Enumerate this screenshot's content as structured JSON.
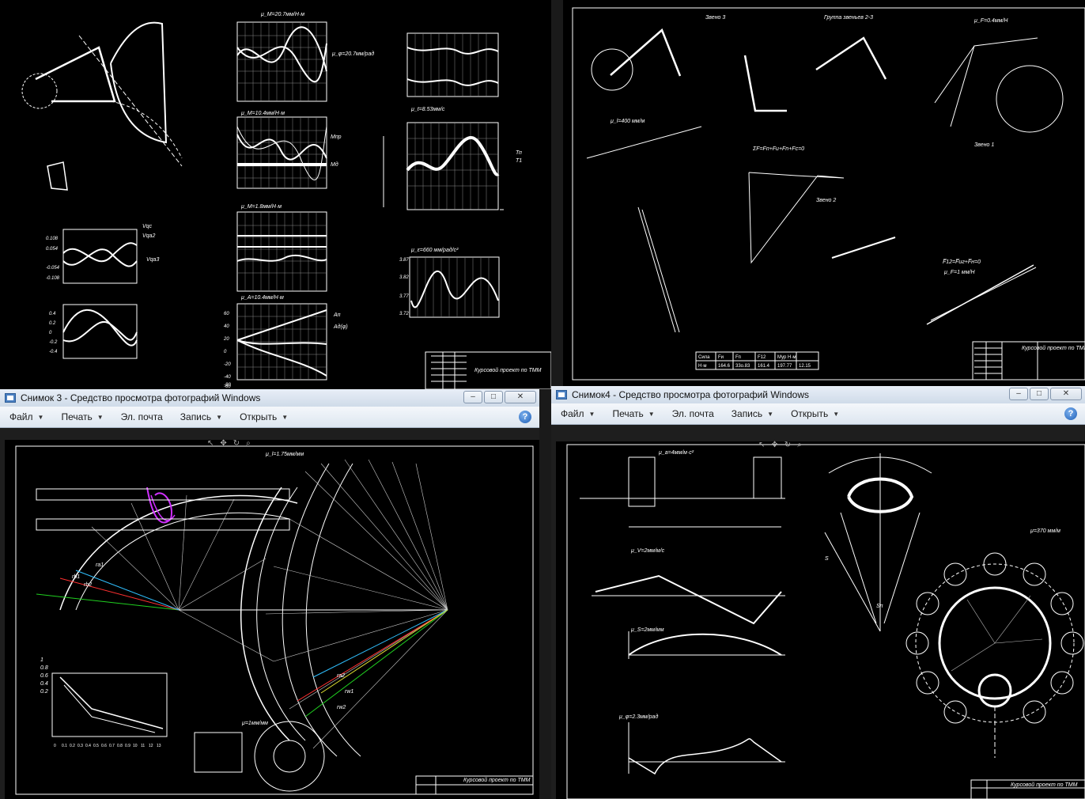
{
  "windows": {
    "photo3": {
      "title": "Снимок 3 - Средство просмотра фотографий Windows",
      "menu": [
        {
          "label": "Файл",
          "has_dropdown": true
        },
        {
          "label": "Печать",
          "has_dropdown": true
        },
        {
          "label": "Эл. почта",
          "has_dropdown": false
        },
        {
          "label": "Запись",
          "has_dropdown": true
        },
        {
          "label": "Открыть",
          "has_dropdown": true
        }
      ],
      "help": "?"
    },
    "photo4": {
      "title": "Снимок4 - Средство просмотра фотографий Windows",
      "menu": [
        {
          "label": "Файл",
          "has_dropdown": true
        },
        {
          "label": "Печать",
          "has_dropdown": true
        },
        {
          "label": "Эл. почта",
          "has_dropdown": false
        },
        {
          "label": "Запись",
          "has_dropdown": true
        },
        {
          "label": "Открыть",
          "has_dropdown": true
        }
      ],
      "help": "?"
    }
  },
  "window_controls": {
    "minimize": "–",
    "maximize": "□",
    "close": "✕"
  },
  "drawings": {
    "top_left": {
      "labels": [
        "μ_M=20.7мм/Н·м",
        "μ_φ=20.7мм/рад",
        "μ_M=10.4мм/Н·м",
        "μ_M=1.8мм/Н·м",
        "μ_A=10.4мм/Н·м",
        "μ_t=8.53мм/с",
        "μ_ε=660 мм/рад/с²",
        "Курсовой проект по ТММ",
        "Vqc",
        "Vqa2",
        "Vqa3",
        "Ап",
        "Ад(φ)",
        "Мпр",
        "Мд",
        "Тп",
        "Т1"
      ],
      "axis_values": [
        "60",
        "40",
        "20",
        "0",
        "-20",
        "-40",
        "-60",
        "-80",
        "0.108",
        "0.054",
        "-0.054",
        "-0.108",
        "0.4",
        "0.2",
        "0",
        "-0.2",
        "-0.4",
        "3.87",
        "3.82",
        "3.77",
        "3.72"
      ]
    },
    "top_right": {
      "labels": [
        "Звено 3",
        "Группа звеньев 2-3",
        "Звено 2",
        "Звено 1",
        "μ_F=0.4мм/Н",
        "μ_l=400 мм/м",
        "Курсовой проект по ТММ",
        "ΣF=Fп+Fи+Fn+Fc=0",
        "F̅12=F̅иг+F̅н=0",
        "μ_F=1 мм/Н"
      ],
      "table": {
        "headers": [
          "Сила",
          "Fи",
          "Fп",
          "F12",
          "Мур Н·м"
        ],
        "row": [
          "Н·м",
          "164.6",
          "33о.83",
          "161.4",
          "197.77",
          "12.15"
        ]
      }
    },
    "bottom_left": {
      "labels": [
        "μ_l=1.75мм/мм",
        "μ=1мм/мм",
        "Курсовой проект по ТММ",
        "rb1",
        "rb2",
        "ra1",
        "ra2",
        "rw1",
        "rw2",
        "0.2",
        "0.4",
        "0.6",
        "0.8",
        "1"
      ],
      "tick_labels": [
        "0",
        "0.1",
        "0.2",
        "0.3",
        "0.4",
        "0.5",
        "0.6",
        "0.7",
        "0.8",
        "0.9",
        "10",
        "11",
        "12",
        "13"
      ]
    },
    "bottom_right": {
      "labels": [
        "μ_a=4мм/м·с²",
        "μ_V=2мм/м/с",
        "μ_S=2мм/мм",
        "μ_φ=2.3мм/рад",
        "μ=370 мм/м",
        "Курсовой проект по ТММ",
        "S",
        "Sп"
      ]
    }
  },
  "colors": {
    "drawing_bg": "#000000",
    "line": "#ffffff",
    "accent_red": "#ff3030",
    "accent_green": "#20d020",
    "accent_cyan": "#30c0ff",
    "accent_magenta": "#d030ff",
    "accent_yellow": "#e0e030"
  }
}
